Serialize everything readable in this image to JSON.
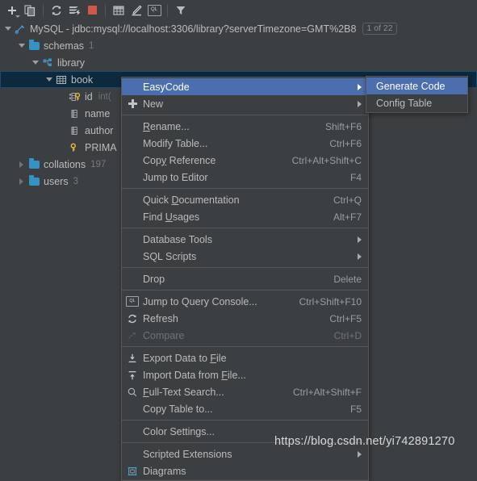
{
  "toolbar": {
    "buttons": [
      {
        "name": "add-icon",
        "label": "Add"
      },
      {
        "name": "duplicate-icon",
        "label": "Duplicate"
      },
      {
        "name": "refresh-icon",
        "label": "Refresh"
      },
      {
        "name": "synchronize-icon",
        "label": "Synchronize"
      },
      {
        "name": "stop-icon",
        "label": "Stop"
      },
      {
        "name": "table-editor-icon",
        "label": "Table Editor"
      },
      {
        "name": "modify-icon",
        "label": "Modify"
      },
      {
        "name": "query-console-icon",
        "label": "QL"
      },
      {
        "name": "filter-icon",
        "label": "Filter"
      }
    ]
  },
  "tree": {
    "nodes": [
      {
        "label": "MySQL - jdbc:mysql://localhost:3306/library?serverTimezone=GMT%2B8",
        "badge": "1 of 22",
        "icon": "datasource-icon",
        "twisty": "down",
        "indent": 0
      },
      {
        "label": "schemas",
        "count": "1",
        "icon": "folder-icon",
        "twisty": "down",
        "indent": 1
      },
      {
        "label": "library",
        "icon": "schema-icon",
        "twisty": "down",
        "indent": 2
      },
      {
        "label": "book",
        "icon": "table-icon",
        "twisty": "down",
        "indent": 3,
        "selected": true
      },
      {
        "label": "id",
        "type": "int(",
        "icon": "primary-column-icon",
        "indent": 4
      },
      {
        "label": "name",
        "icon": "column-icon",
        "indent": 4
      },
      {
        "label": "author",
        "icon": "column-icon",
        "indent": 4
      },
      {
        "label": "PRIMA",
        "icon": "key-icon",
        "indent": 4
      },
      {
        "label": "collations",
        "count": "197",
        "icon": "folder-icon",
        "twisty": "right",
        "indent": 1
      },
      {
        "label": "users",
        "count": "3",
        "icon": "folder-icon",
        "twisty": "right",
        "indent": 1
      }
    ]
  },
  "context_menu": {
    "items": [
      {
        "label": "EasyCode",
        "icon": "",
        "shortcut": "",
        "submenu": true,
        "highlighted": true
      },
      {
        "label": "New",
        "icon": "plus-icon",
        "shortcut": "",
        "submenu": true
      },
      {
        "separator": true
      },
      {
        "label": "Rename...",
        "underline": "R",
        "shortcut": "Shift+F6"
      },
      {
        "label": "Modify Table...",
        "shortcut": "Ctrl+F6"
      },
      {
        "label": "Copy Reference",
        "underline": "y",
        "shortcut": "Ctrl+Alt+Shift+C"
      },
      {
        "label": "Jump to Editor",
        "shortcut": "F4"
      },
      {
        "separator": true
      },
      {
        "label": "Quick Documentation",
        "underline": "D",
        "shortcut": "Ctrl+Q"
      },
      {
        "label": "Find Usages",
        "underline": "U",
        "shortcut": "Alt+F7"
      },
      {
        "separator": true
      },
      {
        "label": "Database Tools",
        "shortcut": "",
        "submenu": true
      },
      {
        "label": "SQL Scripts",
        "shortcut": "",
        "submenu": true
      },
      {
        "separator": true
      },
      {
        "label": "Drop",
        "shortcut": "Delete"
      },
      {
        "separator": true
      },
      {
        "label": "Jump to Query Console...",
        "icon": "query-console-icon",
        "shortcut": "Ctrl+Shift+F10"
      },
      {
        "label": "Refresh",
        "icon": "refresh-icon",
        "shortcut": "Ctrl+F5"
      },
      {
        "label": "Compare",
        "icon": "compare-icon",
        "shortcut": "Ctrl+D",
        "disabled": true
      },
      {
        "separator": true
      },
      {
        "label": "Export Data to File",
        "underline": "F",
        "icon": "export-icon",
        "shortcut": ""
      },
      {
        "label": "Import Data from File...",
        "underline": "F",
        "icon": "import-icon",
        "shortcut": ""
      },
      {
        "label": "Full-Text Search...",
        "underline": "F",
        "icon": "search-icon",
        "shortcut": "Ctrl+Alt+Shift+F"
      },
      {
        "label": "Copy Table to...",
        "shortcut": "F5"
      },
      {
        "separator": true
      },
      {
        "label": "Color Settings...",
        "shortcut": ""
      },
      {
        "separator": true
      },
      {
        "label": "Scripted Extensions",
        "shortcut": "",
        "submenu": true
      },
      {
        "label": "Diagrams",
        "icon": "diagram-icon",
        "shortcut": ""
      }
    ]
  },
  "submenu": {
    "items": [
      {
        "label": "Generate Code",
        "highlighted": true
      },
      {
        "label": "Config Table"
      }
    ]
  },
  "watermark": {
    "text": "https://blog.csdn.net/yi742891270"
  },
  "colors": {
    "background": "#3c3f41",
    "menu_background": "#3c3f41",
    "highlight": "#4b6eaf",
    "selection": "#0d293e",
    "accent_blue": "#3592c4",
    "stop_red": "#d2574b",
    "key_yellow": "#e8b33c",
    "text": "#bbbbbb",
    "muted_text": "#787878",
    "separator": "#565656"
  }
}
